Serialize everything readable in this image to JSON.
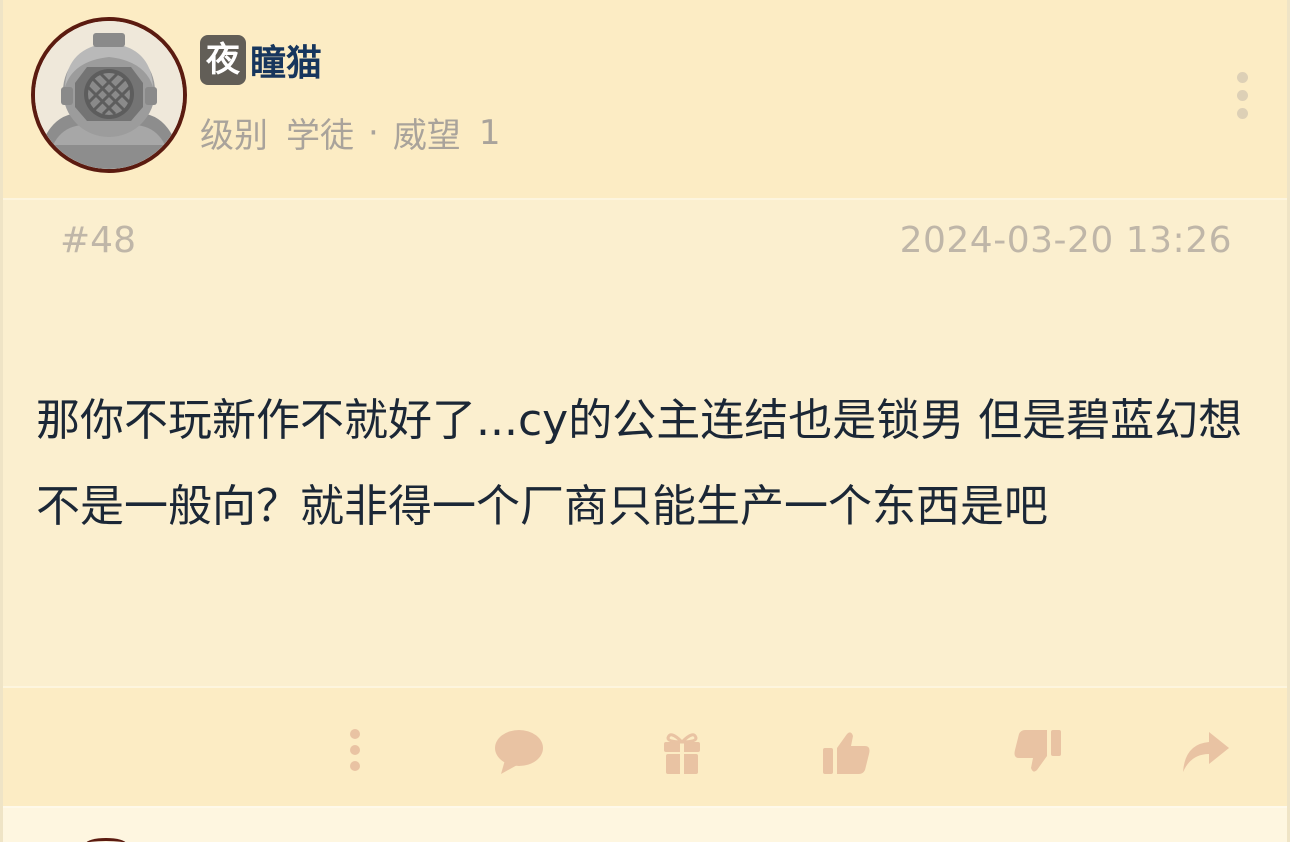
{
  "post": {
    "user": {
      "badge": "夜",
      "name": "瞳猫",
      "level_label": "级别",
      "level_value": "学徒",
      "separator": "·",
      "reputation_label": "威望",
      "reputation_value": "1",
      "avatar_icon": "diving-helmet-avatar"
    },
    "floor": "#48",
    "datetime": "2024-03-20 13:26",
    "content": "那你不玩新作不就好了...cy的公主连结也是锁男 但是碧蓝幻想不是一般向？就非得一个厂商只能生产一个东西是吧",
    "menu_icon": "more-vertical-icon"
  },
  "actions": [
    {
      "name": "more",
      "icon": "more-vertical-icon"
    },
    {
      "name": "comment",
      "icon": "speech-bubble-icon"
    },
    {
      "name": "gift",
      "icon": "gift-icon"
    },
    {
      "name": "like",
      "icon": "thumbs-up-icon"
    },
    {
      "name": "dislike",
      "icon": "thumbs-down-icon"
    },
    {
      "name": "share",
      "icon": "share-arrow-icon"
    }
  ],
  "colors": {
    "background": "#fbefcf",
    "header_bg": "#fcecc4",
    "username": "#17365d",
    "badge_bg": "#625e57",
    "meta_text": "#bfb6a8",
    "level_text": "#a9a39b",
    "content_text": "#1b2736",
    "action_icon": "#e9c3a3",
    "avatar_ring": "#5b1b10"
  }
}
